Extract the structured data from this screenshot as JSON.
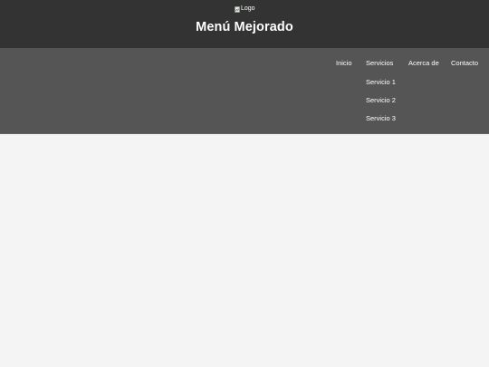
{
  "header": {
    "logo_alt": "Logo",
    "title": "Menú Mejorado"
  },
  "nav": {
    "items": [
      {
        "label": "Inicio"
      },
      {
        "label": "Servicios",
        "submenu": [
          "Servicio 1",
          "Servicio 2",
          "Servicio 3"
        ]
      },
      {
        "label": "Acerca de"
      },
      {
        "label": "Contacto"
      }
    ]
  },
  "colors": {
    "header_bg": "#333333",
    "nav_bg": "#555555",
    "page_bg": "#f4f4f4",
    "text": "#ffffff"
  }
}
